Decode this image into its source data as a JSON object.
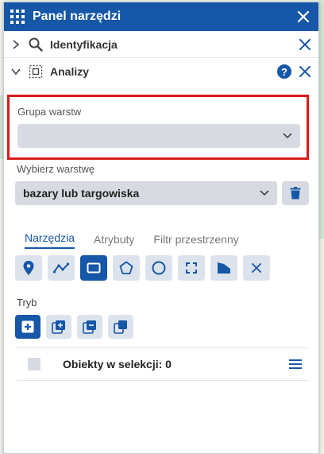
{
  "panel": {
    "title": "Panel narzędzi"
  },
  "sections": {
    "identify_label": "Identyfikacja",
    "analyze_label": "Analizy",
    "help_label": "?"
  },
  "layer_group": {
    "label": "Grupa warstw",
    "value": ""
  },
  "layer_select": {
    "label": "Wybierz warstwę",
    "value": "bazary lub targowiska"
  },
  "tabs": [
    {
      "label": "Narzędzia",
      "active": true
    },
    {
      "label": "Atrybuty",
      "active": false
    },
    {
      "label": "Filtr przestrzenny",
      "active": false
    }
  ],
  "tools": [
    "point-icon",
    "polyline-icon",
    "rectangle-icon",
    "polygon-icon",
    "circle-icon",
    "extent-icon",
    "shape-icon",
    "clear-icon"
  ],
  "mode": {
    "label": "Tryb",
    "buttons": [
      "new-selection-icon",
      "add-selection-icon",
      "remove-selection-icon",
      "intersect-selection-icon"
    ]
  },
  "results": {
    "label": "Obiekty w selekcji: 0"
  },
  "colors": {
    "primary": "#1657a8",
    "highlight": "#d71c1c",
    "control_bg": "#d7dbe1"
  }
}
